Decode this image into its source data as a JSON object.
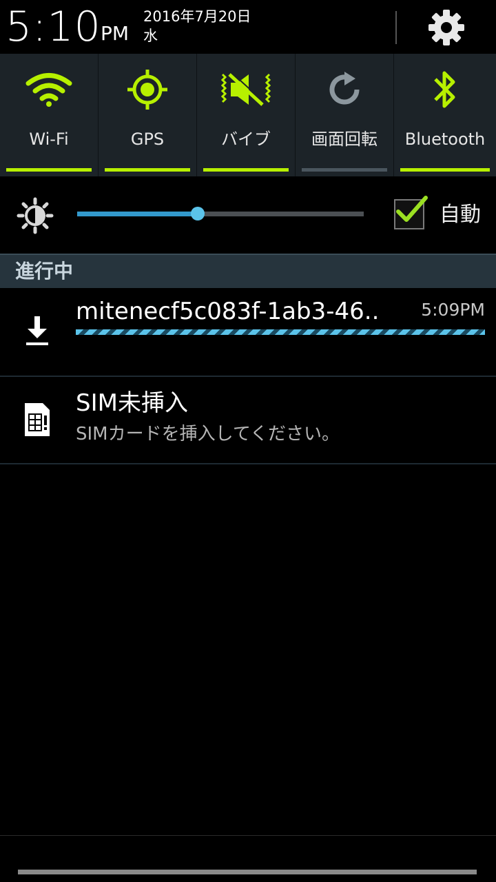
{
  "header": {
    "time": "5:10",
    "ampm": "PM",
    "date": "2016年7月20日",
    "weekday": "水"
  },
  "quick_settings": [
    {
      "label": "Wi-Fi",
      "icon": "wifi-icon",
      "active": true
    },
    {
      "label": "GPS",
      "icon": "gps-icon",
      "active": true
    },
    {
      "label": "バイブ",
      "icon": "vibrate-icon",
      "active": true
    },
    {
      "label": "画面回転",
      "icon": "rotate-icon",
      "active": false
    },
    {
      "label": "Bluetooth",
      "icon": "bluetooth-icon",
      "active": true
    }
  ],
  "brightness": {
    "level_percent": 42,
    "auto_label": "自動",
    "auto_checked": true
  },
  "section": {
    "title": "進行中"
  },
  "notifications": {
    "download": {
      "title": "mitenecf5c083f-1ab3-46..",
      "time": "5:09PM",
      "icon": "download-icon"
    },
    "sim": {
      "title": "SIM未挿入",
      "subtitle": "SIMカードを挿入してください。",
      "icon": "sim-card-icon"
    }
  },
  "colors": {
    "active": "#b7f000",
    "inactive": "#4a565e",
    "accent": "#5bc3ea"
  }
}
